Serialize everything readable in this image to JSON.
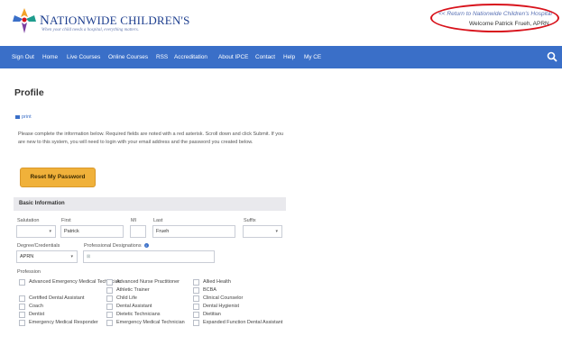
{
  "header": {
    "logo_name_first": "N",
    "logo_name_rest": "ATIONWIDE CHILDREN'S",
    "logo_tagline": "When your child needs a hospital, everything matters.",
    "return_link": "<< Return to Nationwide Children's Hospital",
    "welcome": "Welcome Patrick Frueh, APRN"
  },
  "nav": {
    "items": [
      "Sign Out",
      "Home",
      "Live Courses",
      "Online Courses",
      "RSS",
      "Accreditation",
      "About IPCE",
      "Contact",
      "Help",
      "My CE"
    ],
    "search_icon": "search-icon"
  },
  "page": {
    "title": "Profile",
    "print_label": "print",
    "intro": "Please complete the information below. Required fields are noted with a red asterisk. Scroll down and click Submit. If you are new to this system, you will need to login with your email address and the password you created below.",
    "reset_button": "Reset My Password"
  },
  "basic_info": {
    "header": "Basic Information",
    "salutation_label": "Salutation",
    "salutation_value": "",
    "first_label": "First",
    "first_value": "Patrick",
    "mi_label": "MI",
    "mi_value": "",
    "last_label": "Last",
    "last_value": "Frueh",
    "suffix_label": "Suffix",
    "suffix_value": "",
    "degree_label": "Degree/Credentials",
    "degree_value": "APRN",
    "designations_label": "Professional Designations",
    "designations_value": "",
    "profession_label": "Profession"
  },
  "professions": {
    "col1": [
      "Advanced Emergency Medical Technician",
      "Certified Dental Assistant",
      "Coach",
      "Dentist",
      "Emergency Medical Responder"
    ],
    "col2": [
      "Advanced Nurse Practitioner",
      "Athletic Trainer",
      "Child Life",
      "Dental Assistant",
      "Dietetic Technicians",
      "Emergency Medical Technician"
    ],
    "col3": [
      "Allied Health",
      "BCBA",
      "Clinical Counselor",
      "Dental Hygienist",
      "Dietitian",
      "Expanded Function Dental Assistant"
    ]
  },
  "colors": {
    "nav_bg": "#3a6fc8",
    "accent_button": "#f0b13a",
    "highlight_oval": "#d8121b"
  }
}
